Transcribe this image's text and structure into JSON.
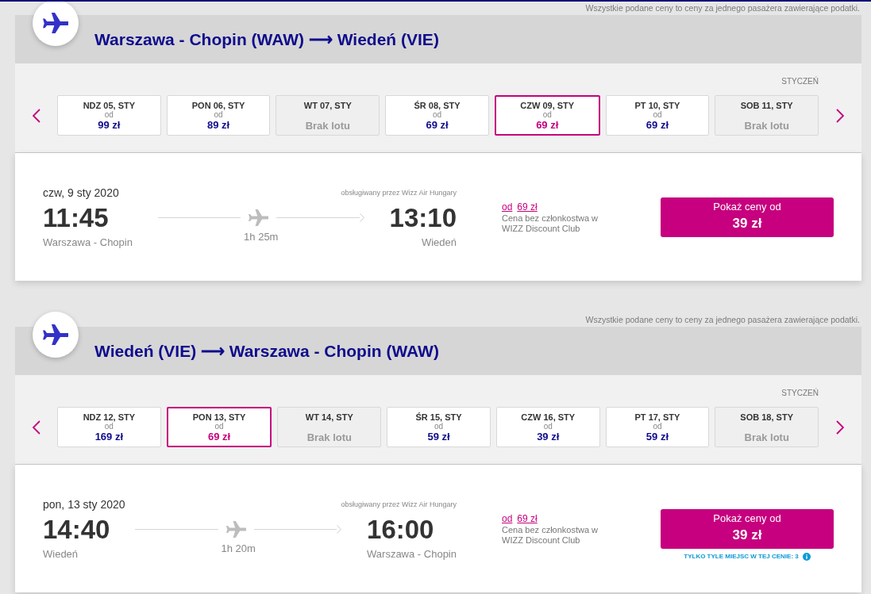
{
  "flights": [
    {
      "note": "Wszystkie podane ceny to ceny za jednego pasażera zawierające podatki.",
      "route": "Warszawa - Chopin (WAW) ⟶ Wiedeń (VIE)",
      "month": "STYCZEŃ",
      "dates": [
        {
          "day": "NDZ 05, STY",
          "kind": "fare",
          "from": "od",
          "price": "99 zł",
          "selected": false
        },
        {
          "day": "PON 06, STY",
          "kind": "fare",
          "from": "od",
          "price": "89 zł",
          "selected": false
        },
        {
          "day": "WT 07, STY",
          "kind": "no-flight",
          "status": "Brak lotu",
          "selected": false
        },
        {
          "day": "ŚR 08, STY",
          "kind": "fare",
          "from": "od",
          "price": "69 zł",
          "selected": false
        },
        {
          "day": "CZW 09, STY",
          "kind": "fare",
          "from": "od",
          "price": "69 zł",
          "selected": true
        },
        {
          "day": "PT 10, STY",
          "kind": "fare",
          "from": "od",
          "price": "69 zł",
          "selected": false
        },
        {
          "day": "SOB 11, STY",
          "kind": "no-flight",
          "status": "Brak lotu",
          "selected": false
        }
      ],
      "flight": {
        "date": "czw, 9 sty 2020",
        "operator": "obsługiwany przez Wizz Air Hungary",
        "departure": {
          "time": "11:45",
          "airport": "Warszawa - Chopin"
        },
        "duration": "1h 25m",
        "arrival": {
          "time": "13:10",
          "airport": "Wiedeń"
        },
        "regular_price": {
          "prefix": "od",
          "price": "69 zł"
        },
        "regular_price_note": "Cena bez członkostwa w WIZZ Discount Club",
        "button": {
          "label": "Pokaż ceny od",
          "price": "39 zł"
        }
      }
    },
    {
      "note": "Wszystkie podane ceny to ceny za jednego pasażera zawierające podatki.",
      "route": "Wiedeń (VIE) ⟶ Warszawa - Chopin (WAW)",
      "month": "STYCZEŃ",
      "dates": [
        {
          "day": "NDZ 12, STY",
          "kind": "fare",
          "from": "od",
          "price": "169 zł",
          "selected": false
        },
        {
          "day": "PON 13, STY",
          "kind": "fare",
          "from": "od",
          "price": "69 zł",
          "selected": true
        },
        {
          "day": "WT 14, STY",
          "kind": "no-flight",
          "status": "Brak lotu",
          "selected": false
        },
        {
          "day": "ŚR 15, STY",
          "kind": "fare",
          "from": "od",
          "price": "59 zł",
          "selected": false
        },
        {
          "day": "CZW 16, STY",
          "kind": "fare",
          "from": "od",
          "price": "39 zł",
          "selected": false
        },
        {
          "day": "PT 17, STY",
          "kind": "fare",
          "from": "od",
          "price": "59 zł",
          "selected": false
        },
        {
          "day": "SOB 18, STY",
          "kind": "no-flight",
          "status": "Brak lotu",
          "selected": false
        }
      ],
      "flight": {
        "date": "pon, 13 sty 2020",
        "operator": "obsługiwany przez Wizz Air Hungary",
        "departure": {
          "time": "14:40",
          "airport": "Wiedeń"
        },
        "duration": "1h 20m",
        "arrival": {
          "time": "16:00",
          "airport": "Warszawa - Chopin"
        },
        "regular_price": {
          "prefix": "od",
          "price": "69 zł"
        },
        "regular_price_note": "Cena bez członkostwa w WIZZ Discount Club",
        "button": {
          "label": "Pokaż ceny od",
          "price": "39 zł"
        },
        "seats_notice": "TYLKO TYLE MIEJSC W TEJ CENIE: 3"
      }
    }
  ]
}
